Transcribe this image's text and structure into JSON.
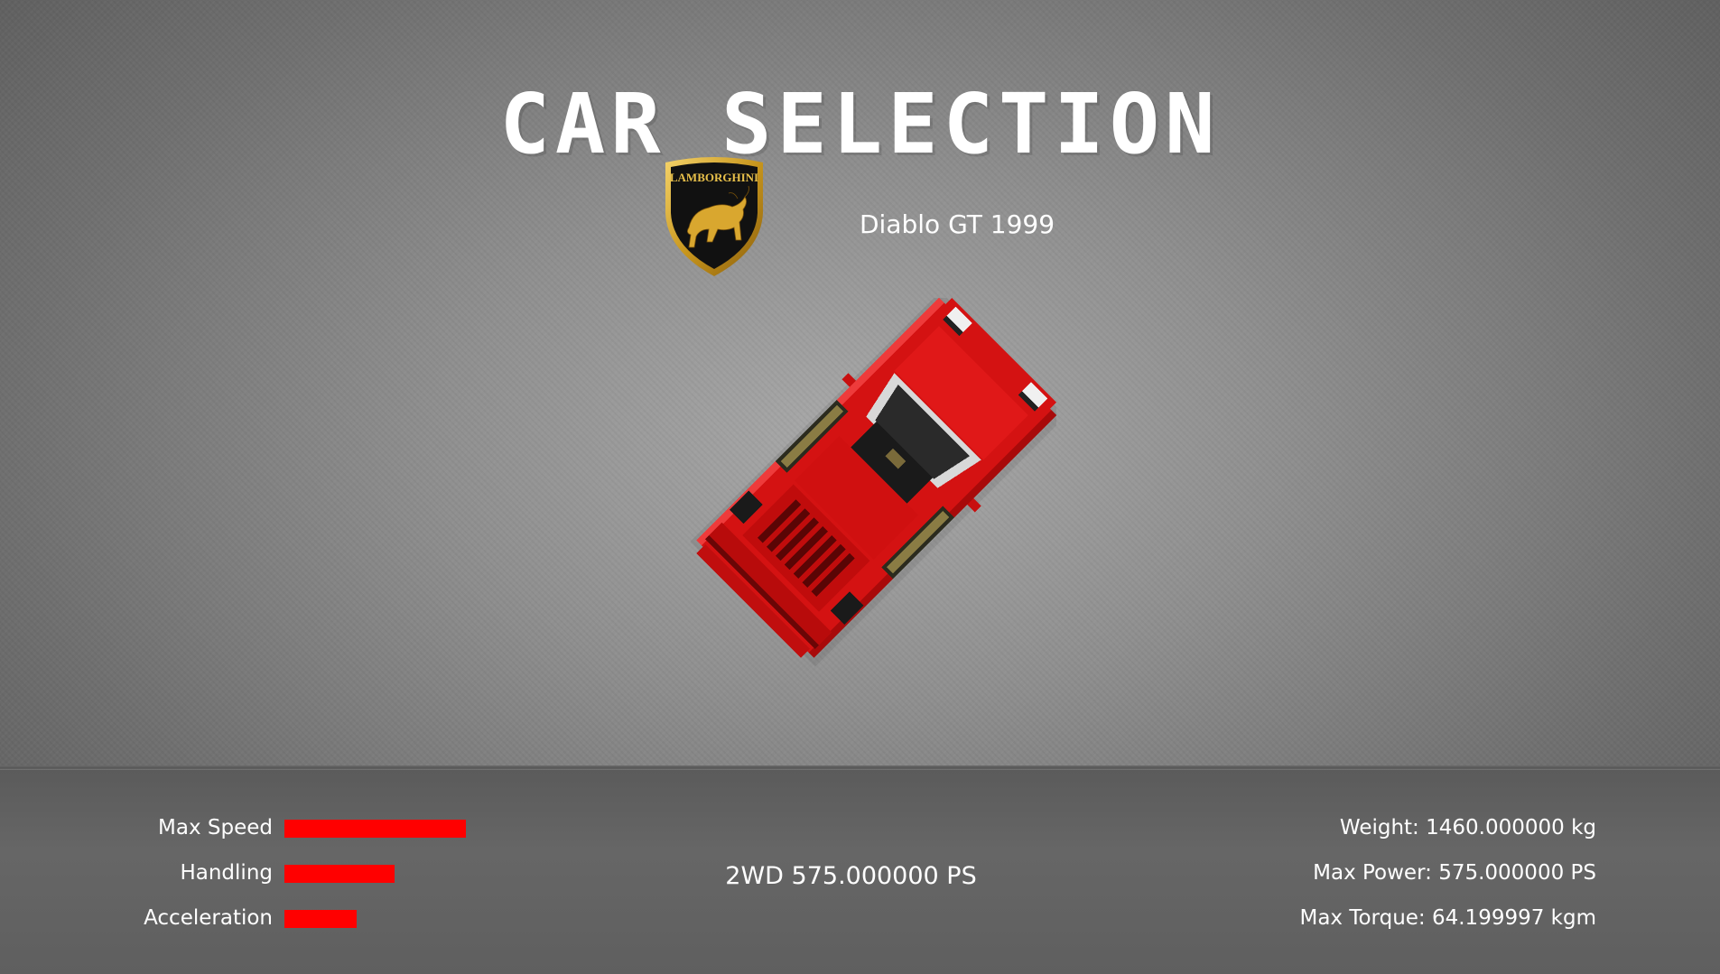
{
  "title": "CAR SELECTION",
  "brand": {
    "name": "LAMBORGHINI",
    "icon": "lamborghini-bull-shield-icon"
  },
  "car": {
    "name": "Diablo GT 1999",
    "color": "#e01010"
  },
  "stats": [
    {
      "label": "Max Speed",
      "level": 0.53
    },
    {
      "label": "Handling",
      "level": 0.32
    },
    {
      "label": "Acceleration",
      "level": 0.21
    }
  ],
  "center_info": "2WD 575.000000 PS",
  "specs": {
    "weight": "Weight: 1460.000000 kg",
    "max_power": "Max Power: 575.000000 PS",
    "max_torque": "Max Torque: 64.199997 kgm"
  },
  "colors": {
    "stat_bar": "#ff0000",
    "text": "#ffffff"
  }
}
